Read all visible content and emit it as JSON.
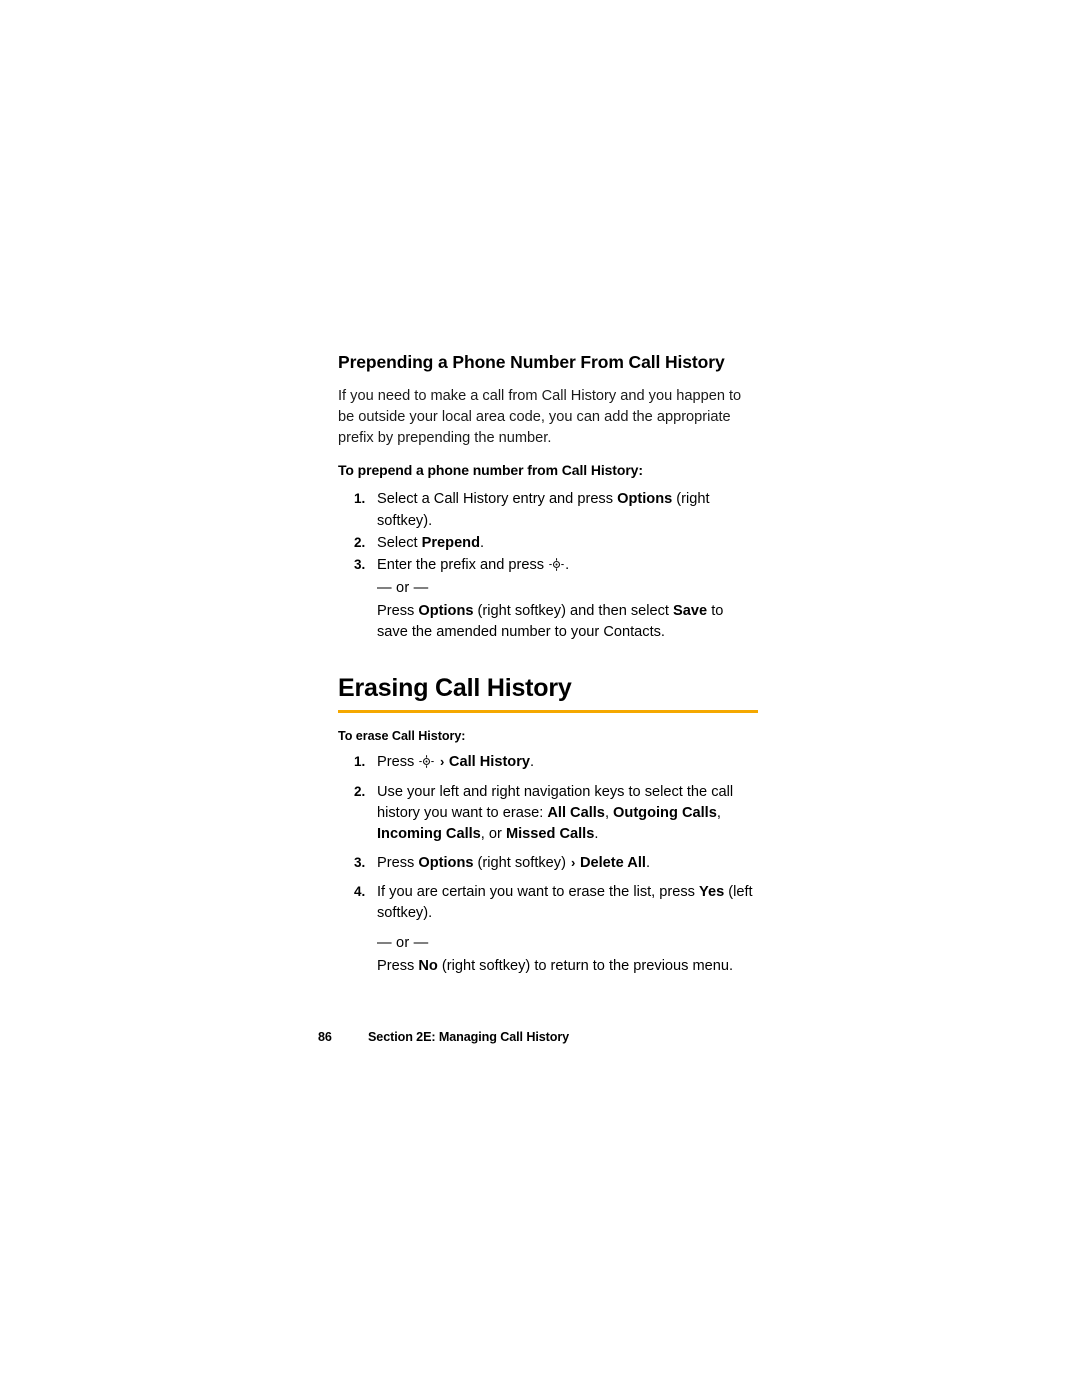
{
  "page": {
    "section_heading": "Prepending a Phone Number From Call History",
    "intro_paragraph": "If you need to make a call from Call History and you happen to be outside your local area code, you can add the appropriate prefix by prepending the number.",
    "prepend": {
      "lead": "To prepend a phone number from Call History:",
      "steps": [
        {
          "num": "1.",
          "parts": [
            {
              "t": "Select a Call History entry and press ",
              "b": false
            },
            {
              "t": "Options",
              "b": true
            },
            {
              "t": " (right softkey).",
              "b": false
            }
          ]
        },
        {
          "num": "2.",
          "parts": [
            {
              "t": "Select ",
              "b": false
            },
            {
              "t": "Prepend",
              "b": true
            },
            {
              "t": ".",
              "b": false
            }
          ]
        },
        {
          "num": "3.",
          "parts": [
            {
              "t": "Enter the prefix and press ",
              "b": false
            },
            {
              "t": "NAVKEY",
              "b": false
            },
            {
              "t": ".",
              "b": false
            }
          ]
        }
      ],
      "or_label": "— or —",
      "alt_parts": [
        {
          "t": "Press ",
          "b": false
        },
        {
          "t": "Options",
          "b": true
        },
        {
          "t": " (right softkey) and then select ",
          "b": false
        },
        {
          "t": "Save",
          "b": true
        },
        {
          "t": " to save the amended number to your Contacts.",
          "b": false
        }
      ]
    },
    "erasing": {
      "title": "Erasing Call History",
      "lead": "To erase Call History:",
      "steps": [
        {
          "num": "1.",
          "parts": [
            {
              "t": "Press ",
              "b": false
            },
            {
              "t": "NAVKEY",
              "b": false
            },
            {
              "t": "GT",
              "b": false
            },
            {
              "t": "Call History",
              "b": true
            },
            {
              "t": ".",
              "b": false
            }
          ]
        },
        {
          "num": "2.",
          "parts": [
            {
              "t": "Use your left and right navigation keys to select the call history you want to erase: ",
              "b": false
            },
            {
              "t": "All Calls",
              "b": true
            },
            {
              "t": ", ",
              "b": false
            },
            {
              "t": "Outgoing Calls",
              "b": true
            },
            {
              "t": ", ",
              "b": false
            },
            {
              "t": "Incoming Calls",
              "b": true
            },
            {
              "t": ", or ",
              "b": false
            },
            {
              "t": "Missed Calls",
              "b": true
            },
            {
              "t": ".",
              "b": false
            }
          ]
        },
        {
          "num": "3.",
          "parts": [
            {
              "t": "Press ",
              "b": false
            },
            {
              "t": "Options",
              "b": true
            },
            {
              "t": " (right softkey) ",
              "b": false
            },
            {
              "t": "GT",
              "b": false
            },
            {
              "t": "Delete All",
              "b": true
            },
            {
              "t": ".",
              "b": false
            }
          ]
        },
        {
          "num": "4.",
          "parts": [
            {
              "t": "If you are certain you want to erase the list, press ",
              "b": false
            },
            {
              "t": "Yes",
              "b": true
            },
            {
              "t": " (left softkey).",
              "b": false
            }
          ]
        }
      ],
      "or_label": "— or —",
      "alt_parts": [
        {
          "t": "Press ",
          "b": false
        },
        {
          "t": "No",
          "b": true
        },
        {
          "t": " (right softkey) to return to the previous menu.",
          "b": false
        }
      ]
    },
    "footer": {
      "page_number": "86",
      "section_label": "Section 2E: Managing Call History"
    },
    "colors": {
      "accent_rule": "#f5a800",
      "text": "#000000"
    }
  }
}
